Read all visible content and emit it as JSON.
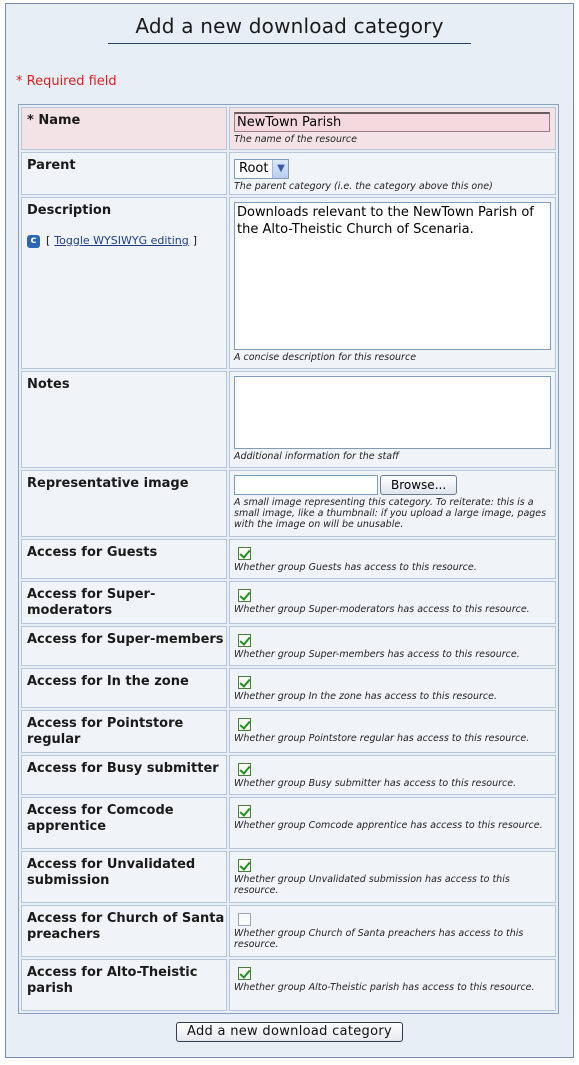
{
  "title": "Add a new download category",
  "required_note": "* Required field",
  "fields": {
    "name": {
      "label": "* Name",
      "value": "NewTown Parish",
      "description": "The name of the resource"
    },
    "parent": {
      "label": "Parent",
      "selected": "Root",
      "description": "The parent category (i.e. the category above this one)"
    },
    "description": {
      "label": "Description",
      "value": "Downloads relevant to the NewTown Parish of the Alto-Theistic Church of Scenaria.",
      "description": "A concise description for this resource",
      "wysiwyg_open": "[",
      "wysiwyg_link": "Toggle WYSIWYG editing",
      "wysiwyg_close": "]",
      "wysiwyg_icon": "c-icon"
    },
    "notes": {
      "label": "Notes",
      "value": "",
      "description": "Additional information for the staff"
    },
    "image": {
      "label": "Representative image",
      "browse_label": "Browse...",
      "description": "A small image representing this category. To reiterate: this is a small image, like a thumbnail: if you upload a large image, pages with the image on will be unusable."
    }
  },
  "access": [
    {
      "label": "Access for Guests",
      "checked": true,
      "description": "Whether group Guests has access to this resource."
    },
    {
      "label": "Access for Super-moderators",
      "checked": true,
      "description": "Whether group Super-moderators has access to this resource."
    },
    {
      "label": "Access for Super-members",
      "checked": true,
      "description": "Whether group Super-members has access to this resource."
    },
    {
      "label": "Access for In the zone",
      "checked": true,
      "description": "Whether group In the zone has access to this resource."
    },
    {
      "label": "Access for Pointstore regular",
      "checked": true,
      "description": "Whether group Pointstore regular has access to this resource."
    },
    {
      "label": "Access for Busy submitter",
      "checked": true,
      "description": "Whether group Busy submitter has access to this resource."
    },
    {
      "label": "Access for Comcode apprentice",
      "checked": true,
      "description": "Whether group Comcode apprentice has access to this resource."
    },
    {
      "label": "Access for Unvalidated submission",
      "checked": true,
      "description": "Whether group Unvalidated submission has access to this resource."
    },
    {
      "label": "Access for Church of Santa preachers",
      "checked": false,
      "description": "Whether group Church of Santa preachers has access to this resource."
    },
    {
      "label": "Access for Alto-Theistic parish",
      "checked": true,
      "description": "Whether group Alto-Theistic parish has access to this resource."
    }
  ],
  "submit_label": "Add a new download category"
}
